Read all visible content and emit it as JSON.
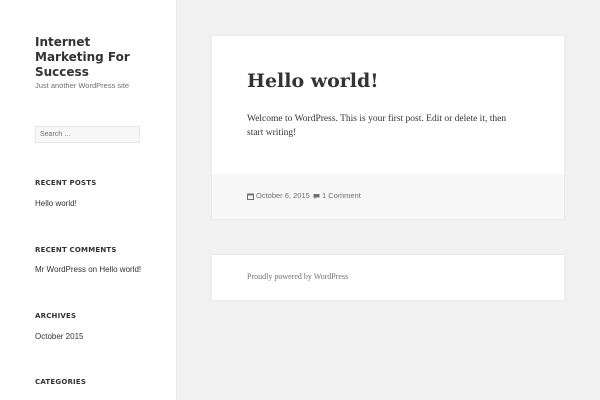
{
  "site": {
    "title": "Internet Marketing For Success",
    "description": "Just another WordPress site"
  },
  "search": {
    "placeholder": "Search …"
  },
  "widgets": {
    "recent_posts": {
      "title": "RECENT POSTS",
      "items": [
        "Hello world!"
      ]
    },
    "recent_comments": {
      "title": "RECENT COMMENTS",
      "author": "Mr WordPress",
      "on": "on",
      "post": "Hello world!"
    },
    "archives": {
      "title": "ARCHIVES",
      "items": [
        "October 2015"
      ]
    },
    "categories": {
      "title": "CATEGORIES"
    }
  },
  "post": {
    "title": "Hello world!",
    "body": "Welcome to WordPress. This is your first post. Edit or delete it, then start writing!",
    "date": "October 6, 2015",
    "comments": "1 Comment"
  },
  "footer": {
    "powered_by": "Proudly powered by WordPress"
  },
  "icons": {
    "date": "calendar-icon",
    "comments": "comment-bubble-icon"
  },
  "colors": {
    "background": "#f1f1f1",
    "sidebar": "#ffffff",
    "text": "#333333",
    "muted": "#707070"
  }
}
